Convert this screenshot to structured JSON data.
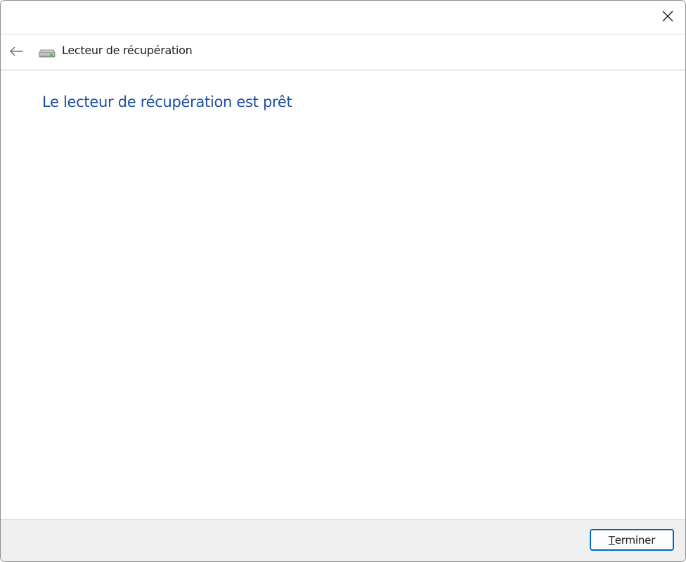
{
  "window": {
    "close_icon": "close-icon"
  },
  "navbar": {
    "back_icon": "back-arrow-icon",
    "drive_icon": "drive-icon",
    "title": "Lecteur de récupération"
  },
  "content": {
    "heading": "Le lecteur de récupération est prêt"
  },
  "footer": {
    "finish_mnemonic": "T",
    "finish_rest": "erminer"
  },
  "colors": {
    "heading": "#1e4fa0",
    "button_border": "#0067c0",
    "footer_bg": "#f0f0f0"
  }
}
